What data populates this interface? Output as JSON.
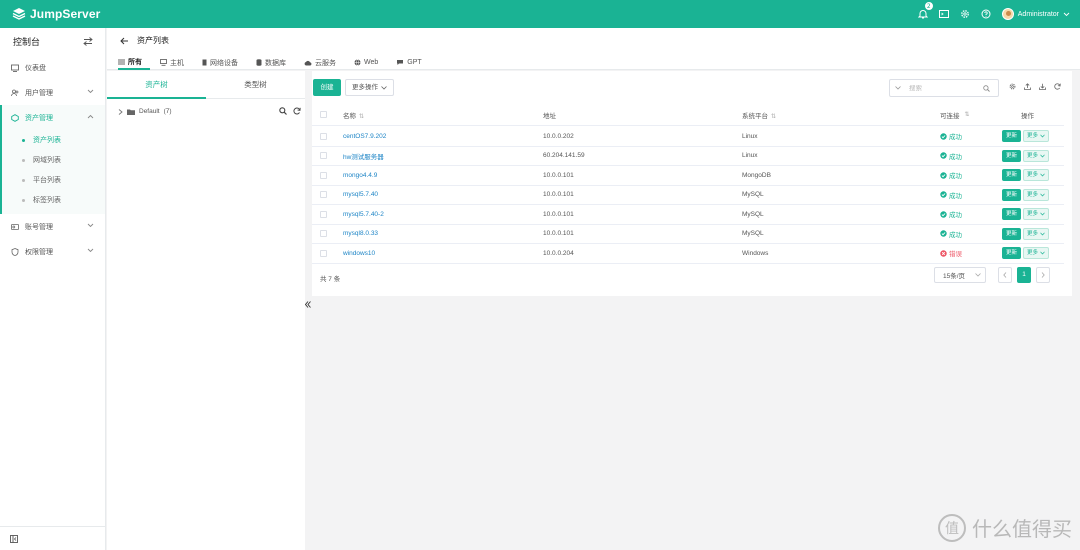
{
  "app": {
    "brand": "JumpServer",
    "accent": "#1ab394"
  },
  "topbar": {
    "notification_count": "2",
    "user_name": "Administrator",
    "icons": [
      "bell-icon",
      "terminal-icon",
      "gear-icon",
      "help-icon"
    ]
  },
  "sidebar": {
    "title": "控制台",
    "items": [
      {
        "label": "仪表盘",
        "icon": "dashboard-icon"
      },
      {
        "label": "用户管理",
        "icon": "users-icon"
      },
      {
        "label": "资产管理",
        "icon": "assets-icon"
      },
      {
        "label": "账号管理",
        "icon": "account-icon"
      },
      {
        "label": "权限管理",
        "icon": "permission-icon"
      }
    ],
    "sub_items": [
      "资产列表",
      "网域列表",
      "平台列表",
      "标签列表"
    ]
  },
  "header": {
    "title": "资产列表",
    "tabs": [
      "所有",
      "主机",
      "网络设备",
      "数据库",
      "云服务",
      "Web",
      "GPT"
    ]
  },
  "tree": {
    "tabs": [
      "资产树",
      "类型树"
    ],
    "node": "Default",
    "node_count": "(7)"
  },
  "toolbar": {
    "create_label": "创建",
    "more_label": "更多操作",
    "search_placeholder": "搜索"
  },
  "table": {
    "columns": [
      "名称",
      "地址",
      "系统平台",
      "可连接",
      "操作"
    ],
    "rows": [
      {
        "name": "centOS7.9.202",
        "address": "10.0.0.202",
        "platform": "Linux",
        "status": "成功",
        "ok": true
      },
      {
        "name": "hw测试服务器",
        "address": "60.204.141.59",
        "platform": "Linux",
        "status": "成功",
        "ok": true
      },
      {
        "name": "mongo4.4.9",
        "address": "10.0.0.101",
        "platform": "MongoDB",
        "status": "成功",
        "ok": true
      },
      {
        "name": "mysql5.7.40",
        "address": "10.0.0.101",
        "platform": "MySQL",
        "status": "成功",
        "ok": true
      },
      {
        "name": "mysql5.7.40-2",
        "address": "10.0.0.101",
        "platform": "MySQL",
        "status": "成功",
        "ok": true
      },
      {
        "name": "mysql8.0.33",
        "address": "10.0.0.101",
        "platform": "MySQL",
        "status": "成功",
        "ok": true
      },
      {
        "name": "windows10",
        "address": "10.0.0.204",
        "platform": "Windows",
        "status": "错误",
        "ok": false
      }
    ],
    "update_label": "更新",
    "more_label": "更多"
  },
  "pagination": {
    "total_text": "共 7 条",
    "page_size": "15条/页",
    "current_page": "1"
  },
  "watermark": "什么值得买",
  "watermark_mark": "值"
}
